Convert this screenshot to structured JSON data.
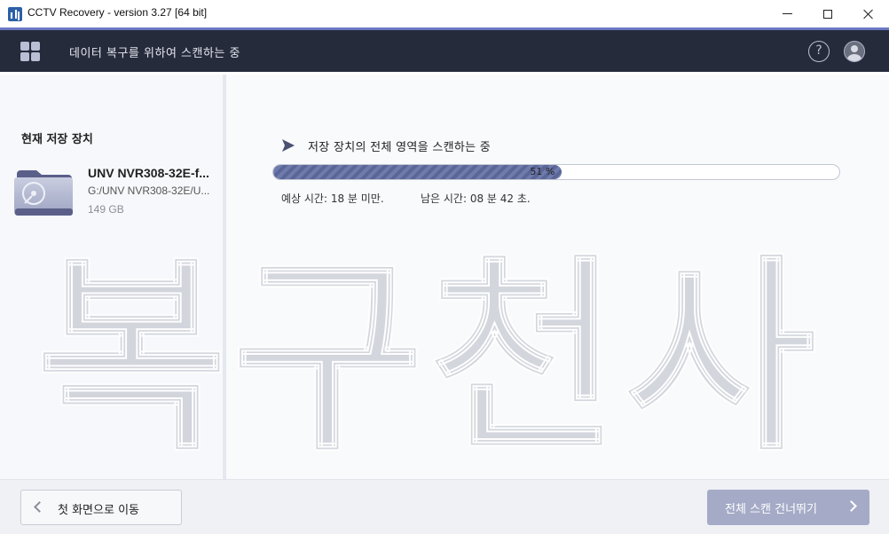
{
  "window": {
    "title": "CCTV Recovery - version 3.27 [64 bit]"
  },
  "header": {
    "title": "데이터 복구를 위하여 스캔하는 중",
    "help_symbol": "?",
    "menu_icon": "grid-icon",
    "user_icon": "user-icon"
  },
  "sidebar": {
    "heading": "현재 저장 장치",
    "device": {
      "name": "UNV NVR308-32E-f...",
      "path": "G:/UNV NVR308-32E/U...",
      "size": "149 GB"
    }
  },
  "scan": {
    "title": "저장 장치의 전체 영역을 스캔하는 중",
    "progress_percent": 51,
    "progress_label": "51 %",
    "estimated_label": "예상 시간:  18 분 미만.",
    "remaining_label": "남은 시간:  08 분  42 초."
  },
  "watermark": {
    "text": "복구천사"
  },
  "footer": {
    "back_label": "첫 화면으로 이동",
    "skip_label": "전체 스캔 건너뛰기"
  },
  "colors": {
    "header_bg": "#262b3c",
    "accent": "#6a77c2",
    "progress_fill": "#5a6697",
    "skip_button": "#a5abc7"
  }
}
